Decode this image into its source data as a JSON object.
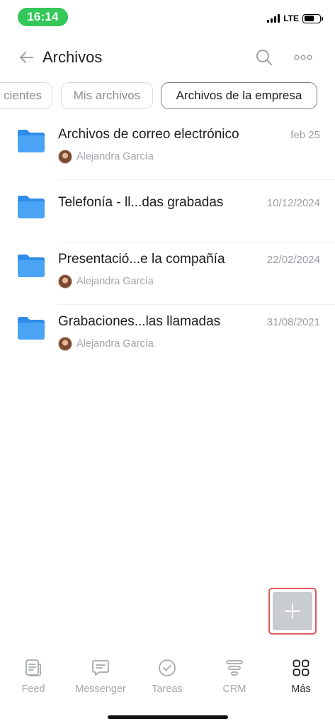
{
  "status_bar": {
    "time": "16:14",
    "network": "LTE",
    "time_pill_color": "#34c759"
  },
  "header": {
    "title": "Archivos",
    "back_icon": "arrow-left-icon",
    "search_icon": "search-icon",
    "more_icon": "more-horizontal-icon"
  },
  "tabs": [
    {
      "label": "Recientes",
      "visible_label": "cientes",
      "active": false
    },
    {
      "label": "Mis archivos",
      "active": false
    },
    {
      "label": "Archivos de la empresa",
      "active": true
    }
  ],
  "files": [
    {
      "name": "Archivos de correo electrónico",
      "date": "feb 25",
      "owner": "Alejandra García",
      "icon": "folder-icon"
    },
    {
      "name": "Telefonía - ll...das grabadas",
      "date": "10/12/2024",
      "owner": "",
      "icon": "folder-icon"
    },
    {
      "name": "Presentació...e la compañía",
      "date": "22/02/2024",
      "owner": "Alejandra García",
      "icon": "folder-icon"
    },
    {
      "name": "Grabaciones...las llamadas",
      "date": "31/08/2021",
      "owner": "Alejandra García",
      "icon": "folder-icon"
    }
  ],
  "fab": {
    "icon": "plus-icon",
    "highlight_color": "#e0585a"
  },
  "nav": [
    {
      "label": "Feed",
      "icon": "feed-icon",
      "active": false
    },
    {
      "label": "Messenger",
      "icon": "chat-icon",
      "active": false
    },
    {
      "label": "Tareas",
      "icon": "check-circle-icon",
      "active": false
    },
    {
      "label": "CRM",
      "icon": "filter-icon",
      "active": false
    },
    {
      "label": "Más",
      "icon": "grid-icon",
      "active": true
    }
  ],
  "colors": {
    "folder": "#4aa3f5",
    "folder_tab": "#2f8ce8",
    "muted_text": "#9a9ea4"
  }
}
